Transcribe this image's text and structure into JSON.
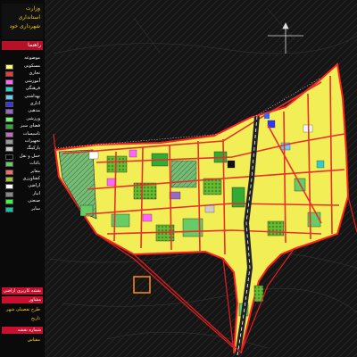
{
  "title_block": {
    "line1": "وزارت",
    "line2": "استانداری",
    "line3": "شهرداری خود"
  },
  "legend": {
    "header": "راهنما",
    "subtitle": "موضوعه",
    "items": [
      {
        "label": "مسکونی",
        "color": "#ffff66"
      },
      {
        "label": "تجاری",
        "color": "#ff3333"
      },
      {
        "label": "آموزشی",
        "color": "#ff66ff"
      },
      {
        "label": "فرهنگی",
        "color": "#33cccc"
      },
      {
        "label": "بهداشتی",
        "color": "#66ccff"
      },
      {
        "label": "اداری",
        "color": "#3333ff"
      },
      {
        "label": "مذهبی",
        "color": "#9966cc"
      },
      {
        "label": "ورزشی",
        "color": "#66ff66"
      },
      {
        "label": "فضای سبز",
        "color": "#33aa33"
      },
      {
        "label": "تاسیسات",
        "color": "#cc66cc"
      },
      {
        "label": "تجهیزات",
        "color": "#999999"
      },
      {
        "label": "پارکینگ",
        "color": "#cccccc"
      },
      {
        "label": "حمل و نقل",
        "color": "#000000"
      },
      {
        "label": "باغات",
        "color": "#66cc66"
      },
      {
        "label": "معابر",
        "color": "#ff6666"
      },
      {
        "label": "کشاورزی",
        "color": "#99cc33"
      },
      {
        "label": "اراضی",
        "color": "#ffffff"
      },
      {
        "label": "انبار",
        "color": "#888888"
      },
      {
        "label": "صنعتی",
        "color": "#33ff33"
      },
      {
        "label": "سایر",
        "color": "#00ccaa"
      }
    ]
  },
  "info": {
    "bar1": "نقشه کاربری اراضی",
    "bar2": "مشاور",
    "bar3": "شماره نقشه",
    "text1": "طرح تفصیلی شهر",
    "text2": "تاریخ",
    "text3": "مقیاس"
  },
  "map": {
    "background": "#1a1a1a",
    "boundary_color": "#e02020",
    "residential_color": "#ffff66",
    "road_color": "#e53030"
  }
}
